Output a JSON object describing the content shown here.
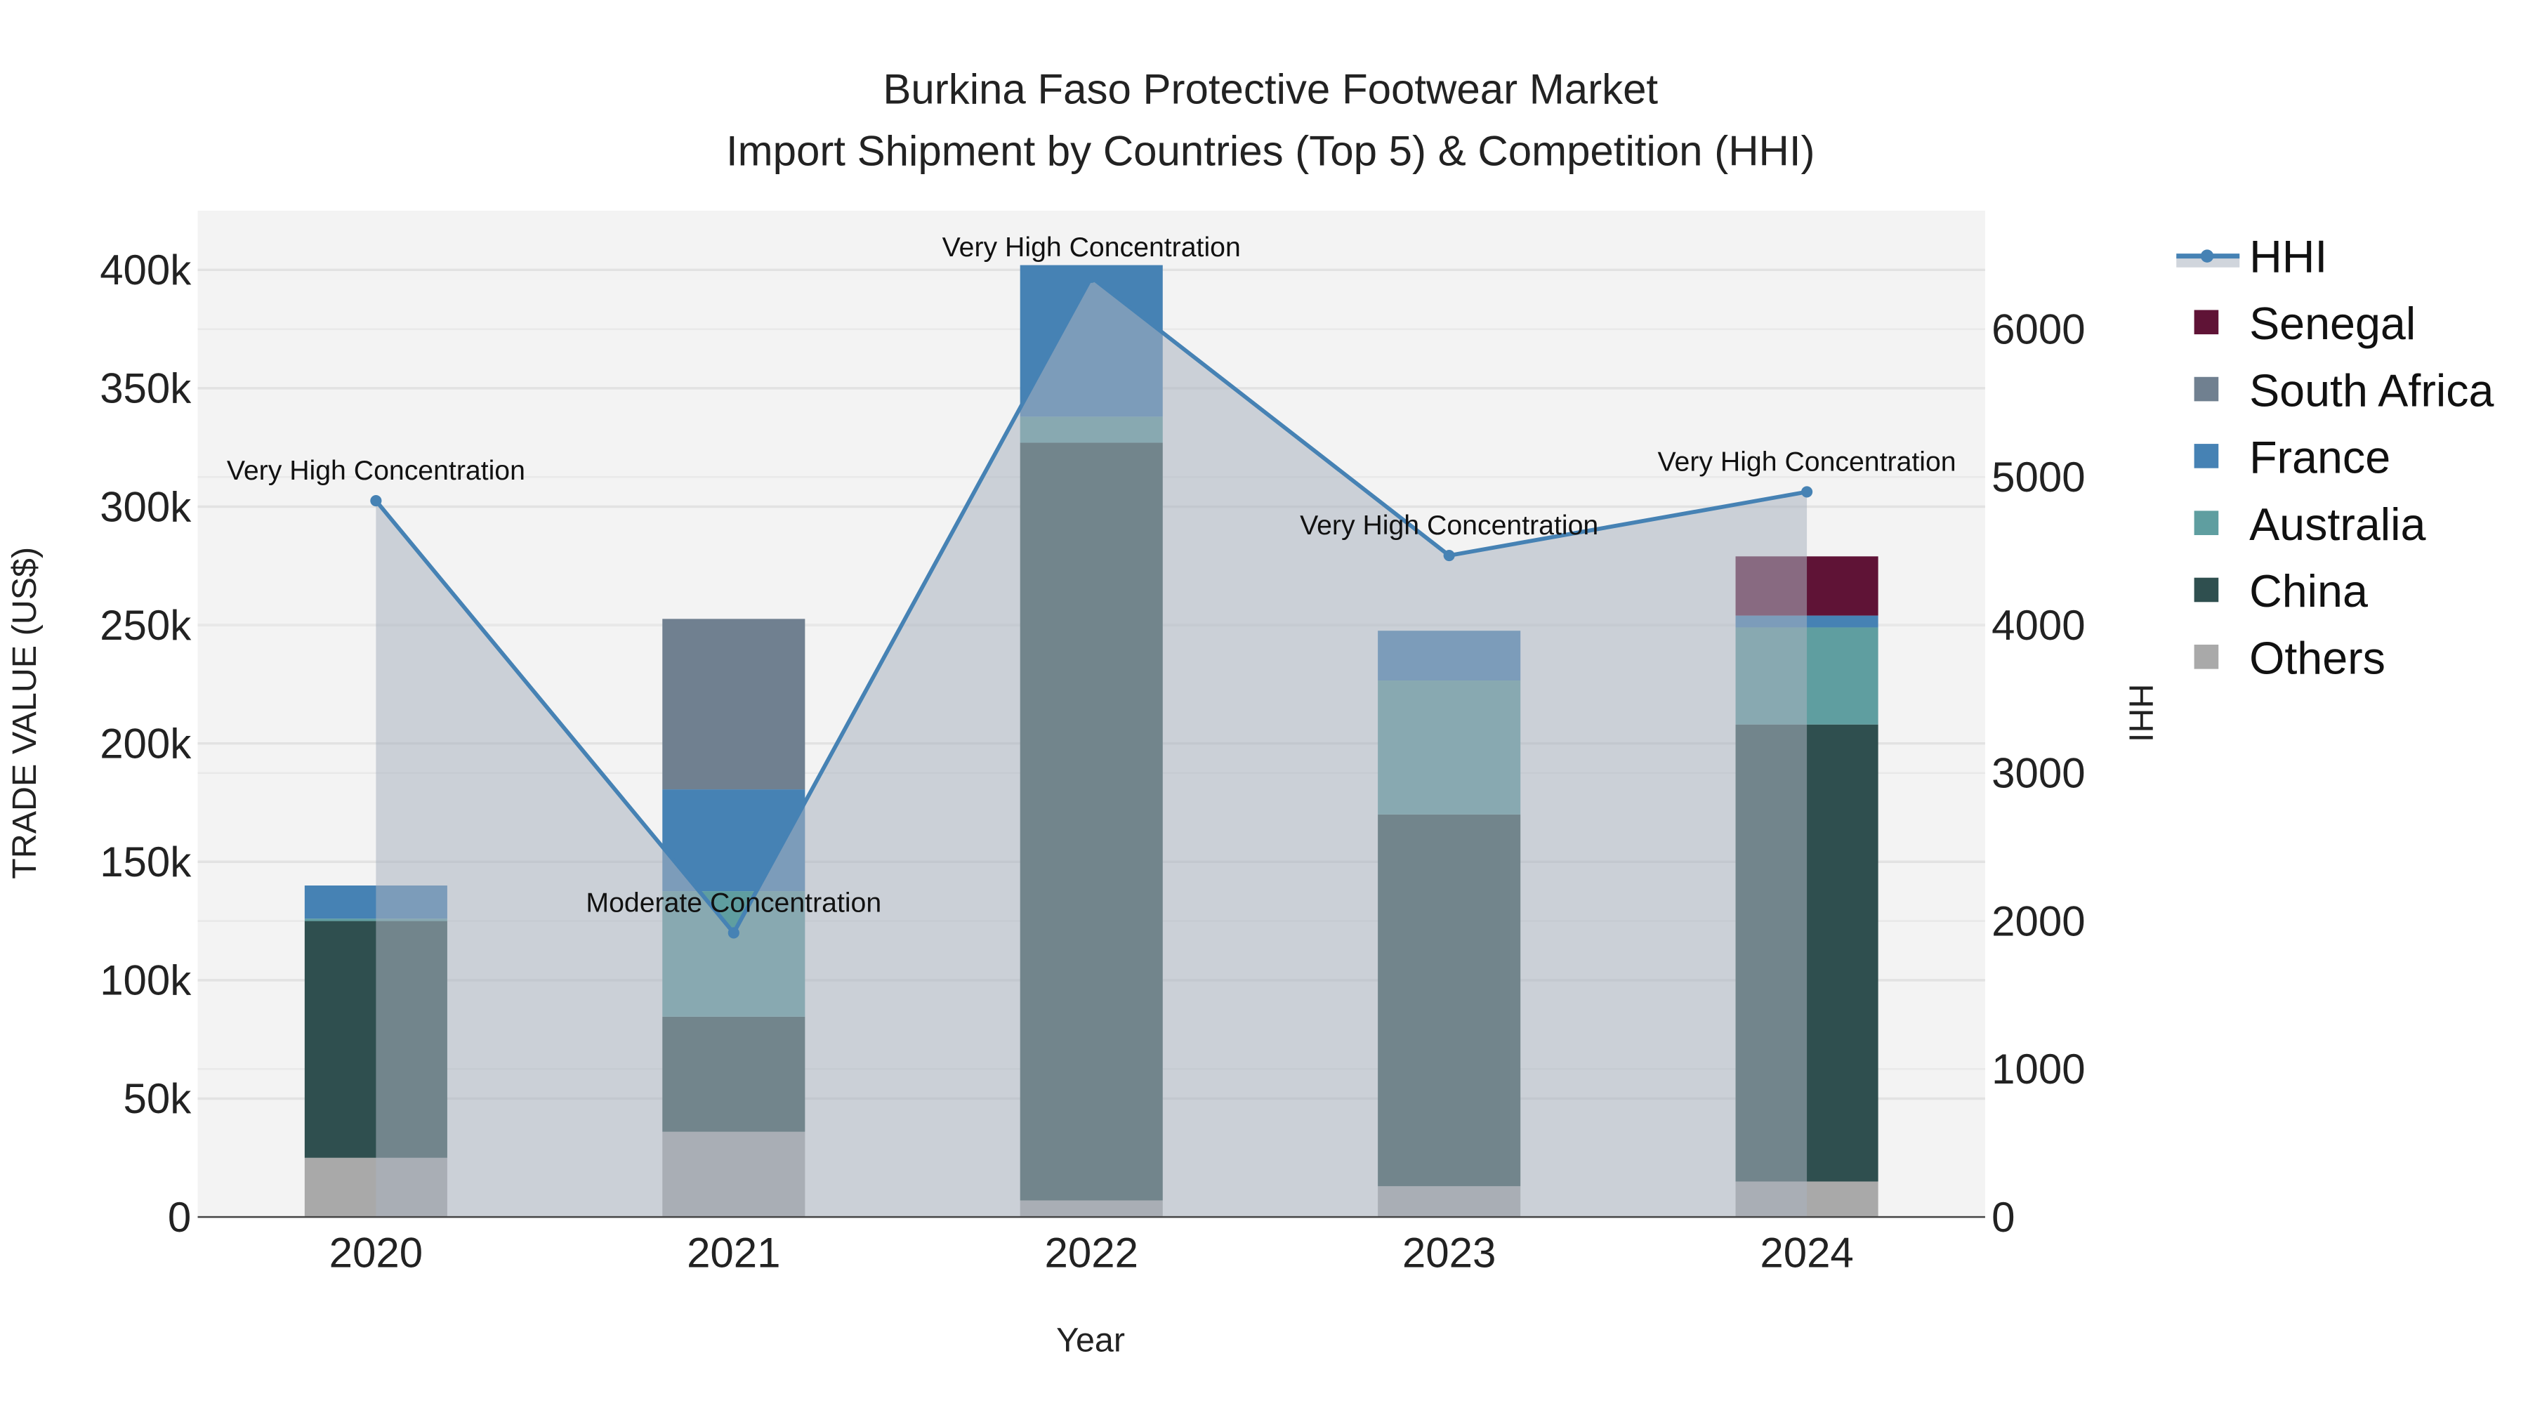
{
  "chart_data": {
    "type": "bar",
    "title_line1": "Burkina Faso Protective Footwear Market",
    "title_line2": "Import Shipment by Countries (Top 5) & Competition (HHI)",
    "xlabel": "Year",
    "ylabel": "TRADE VALUE (US$)",
    "y2label": "HHI",
    "categories": [
      "2020",
      "2021",
      "2022",
      "2023",
      "2024"
    ],
    "ylim": [
      0,
      425000
    ],
    "y2lim": [
      0,
      6800
    ],
    "yticks": [
      0,
      50000,
      100000,
      150000,
      200000,
      250000,
      300000,
      350000,
      400000
    ],
    "ytick_labels": [
      "0",
      "50k",
      "100k",
      "150k",
      "200k",
      "250k",
      "300k",
      "350k",
      "400k"
    ],
    "y2ticks": [
      0,
      1000,
      2000,
      3000,
      4000,
      5000,
      6000
    ],
    "y2tick_labels": [
      "0",
      "1000",
      "2000",
      "3000",
      "4000",
      "5000",
      "6000"
    ],
    "series": [
      {
        "name": "Others",
        "color": "#a9a9a9",
        "values": [
          25000,
          36000,
          7000,
          13000,
          15000
        ]
      },
      {
        "name": "China",
        "color": "#2f4f4f",
        "values": [
          100000,
          48600,
          320000,
          157000,
          193000
        ]
      },
      {
        "name": "Australia",
        "color": "#5f9ea0",
        "values": [
          1000,
          53000,
          11000,
          56600,
          41000
        ]
      },
      {
        "name": "France",
        "color": "#4682b4",
        "values": [
          14000,
          43000,
          64000,
          21000,
          5000
        ]
      },
      {
        "name": "South Africa",
        "color": "#708090",
        "values": [
          0,
          72000,
          0,
          0,
          0
        ]
      },
      {
        "name": "Senegal",
        "color": "#5f1336",
        "values": [
          0,
          0,
          0,
          0,
          25000
        ]
      }
    ],
    "hhi": {
      "name": "HHI",
      "color": "#4682b4",
      "values": [
        4840,
        1920,
        6350,
        4470,
        4900
      ],
      "annotations": [
        "Very High Concentration",
        "Moderate Concentration",
        "Very High Concentration",
        "Very High Concentration",
        "Very High Concentration"
      ]
    },
    "legend": [
      "HHI",
      "Senegal",
      "South Africa",
      "France",
      "Australia",
      "China",
      "Others"
    ],
    "legend_position": "right",
    "grid": true
  }
}
